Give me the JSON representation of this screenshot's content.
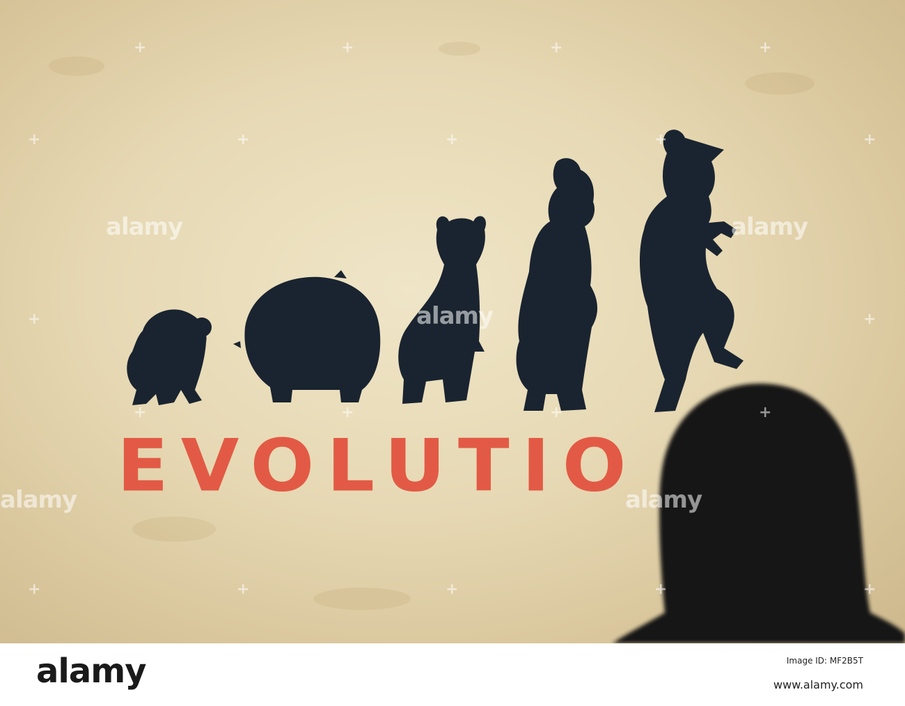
{
  "mural": {
    "word": "EVOLUTIO",
    "word_color": "#e25a45",
    "silhouette_color": "#1a2430",
    "figures": [
      "ape-silhouette",
      "bear-silhouette",
      "horned-creature-silhouette",
      "cloaked-man-silhouette",
      "dancing-man-silhouette"
    ]
  },
  "watermark": {
    "text": "alamy"
  },
  "footer": {
    "brand": "alamy",
    "image_id_label": "Image ID: MF2B5T",
    "website": "www.alamy.com"
  }
}
